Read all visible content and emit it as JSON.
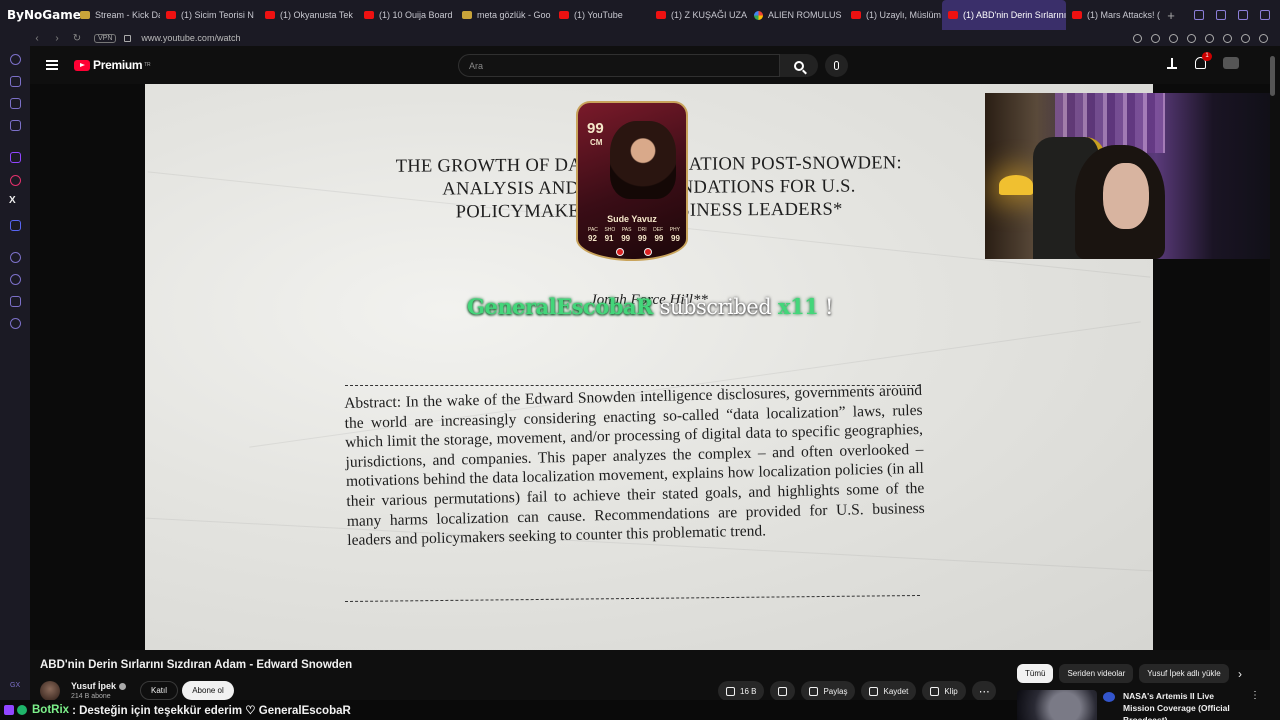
{
  "browser": {
    "brand": "ByNoGame",
    "tabs": [
      {
        "title": "Stream - Kick Das",
        "favicon": "kick-icon"
      },
      {
        "title": "(1) Sicim Teorisi N",
        "favicon": "youtube-icon"
      },
      {
        "title": "(1) Okyanusta Tek",
        "favicon": "youtube-icon"
      },
      {
        "title": "(1) 10 Ouija Board",
        "favicon": "youtube-icon"
      },
      {
        "title": "meta gözlük - Goo",
        "favicon": "meta-icon"
      },
      {
        "title": "(1) YouTube",
        "favicon": "youtube-icon"
      },
      {
        "title": "(1) Z KUŞAĞI UZA",
        "favicon": "youtube-icon"
      },
      {
        "title": "ALIEN ROMULUS",
        "favicon": "google-icon"
      },
      {
        "title": "(1) Uzaylı, Müslüm",
        "favicon": "youtube-icon"
      },
      {
        "title": "(1) ABD'nin Derin Sırlarını",
        "favicon": "youtube-icon",
        "active": true
      },
      {
        "title": "(1) Mars Attacks! (",
        "favicon": "youtube-icon"
      }
    ],
    "new_tab": "+",
    "vpn": "VPN",
    "url": "www.youtube.com/watch",
    "accent": "#8b7ed8"
  },
  "youtube": {
    "logo": "Premium",
    "logo_sup": "TR",
    "search_placeholder": "Ara",
    "notification_count": "1"
  },
  "video_content": {
    "doc_title_lines": [
      "THE GROWTH OF DATA LOCALIZATION POST-SNOWDEN:",
      "ANALYSIS AND RECOMMENDATIONS FOR U.S.",
      "POLICYMAKERS AND BUSINESS LEADERS*"
    ],
    "doc_author": "Jonah Force Hill**",
    "abstract": "Abstract: In the wake of the Edward Snowden intelligence disclosures, governments around the world are increasingly considering enacting so-called “data localization” laws, rules which limit the storage, movement, and/or processing of digital data to specific geographies, jurisdictions, and companies. This paper analyzes the complex – and often overlooked – motivations behind the data localization movement, explains how localization policies (in all their various permutations) fail to achieve their stated goals, and highlights some of the many harms localization can cause. Recommendations are provided for U.S. business leaders and policymakers seeking to counter this problematic trend."
  },
  "overlay": {
    "card": {
      "rating": "99",
      "position": "CM",
      "name": "Sude Yavuz",
      "stat_labels": [
        "PAC",
        "SHO",
        "PAS",
        "DRI",
        "DEF",
        "PHY"
      ],
      "stat_values": [
        "92",
        "91",
        "99",
        "99",
        "99",
        "99"
      ]
    },
    "sub_alert": {
      "name": "GeneralEscobaR",
      "text": "subscribed",
      "count": "x11",
      "suffix": "!"
    }
  },
  "video": {
    "title": "ABD'nin Derin Sırlarını Sızdıran Adam - Edward Snowden",
    "channel": "Yusuf İpek",
    "subscribers": "214 B abone",
    "join_label": "Katıl",
    "subscribe_label": "Abone ol",
    "likes": "16 B",
    "share_label": "Paylaş",
    "save_label": "Kaydet",
    "clip_label": "Klip",
    "more_label": "⋯"
  },
  "recommendations": {
    "chips": [
      "Tümü",
      "Seriden videolar",
      "Yusuf İpek adlı yükle"
    ],
    "items": [
      {
        "title": "NASA's Artemis II Live Mission Coverage (Official Broadcast)"
      }
    ]
  },
  "ticker": {
    "user": "BotRix",
    "message": ": Desteğin için teşekkür ederim ♡ GeneralEscobaR"
  }
}
